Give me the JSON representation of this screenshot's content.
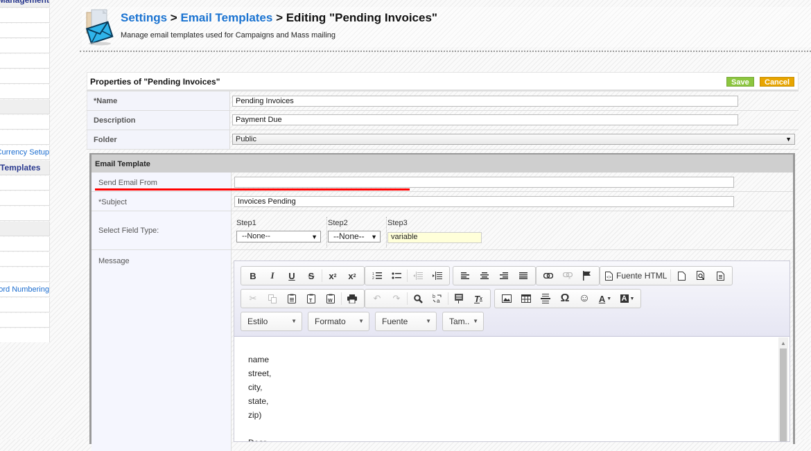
{
  "sidebar": {
    "items": [
      {
        "label": "Management",
        "type": "head"
      },
      {
        "label": "",
        "type": "item"
      },
      {
        "label": "",
        "type": "item"
      },
      {
        "label": "",
        "type": "item"
      },
      {
        "label": "",
        "type": "item"
      },
      {
        "label": "",
        "type": "item"
      },
      {
        "label": "",
        "type": "head"
      },
      {
        "label": "",
        "type": "item"
      },
      {
        "label": "",
        "type": "item"
      },
      {
        "label": "Currency Setup",
        "type": "link"
      },
      {
        "label": "Templates",
        "type": "head"
      },
      {
        "label": "",
        "type": "item"
      },
      {
        "label": "",
        "type": "item"
      },
      {
        "label": "",
        "type": "item"
      },
      {
        "label": "",
        "type": "head"
      },
      {
        "label": "",
        "type": "item"
      },
      {
        "label": "",
        "type": "item"
      },
      {
        "label": "",
        "type": "item"
      },
      {
        "label": "Record Numbering",
        "type": "link"
      },
      {
        "label": "",
        "type": "item"
      },
      {
        "label": "",
        "type": "item"
      },
      {
        "label": "",
        "type": "item"
      }
    ]
  },
  "header": {
    "breadcrumb": {
      "settings": "Settings",
      "sep1": " > ",
      "email_templates": "Email Templates",
      "sep2": " > ",
      "current": "Editing \"Pending Invoices\""
    },
    "subtitle": "Manage email templates used for Campaigns and Mass mailing"
  },
  "properties": {
    "title": "Properties of \"Pending Invoices\"",
    "save_label": "Save",
    "cancel_label": "Cancel",
    "name": {
      "required_mark": "*",
      "label": "Name",
      "value": "Pending Invoices"
    },
    "description": {
      "label": "Description",
      "value": "Payment Due"
    },
    "folder": {
      "label": "Folder",
      "value": "Public"
    }
  },
  "email_template": {
    "title": "Email Template",
    "send_from": {
      "label": "Send Email From",
      "value": ""
    },
    "subject": {
      "required_mark": "*",
      "label": "Subject",
      "value": "Invoices Pending"
    },
    "field_type": {
      "label": "Select Field Type:",
      "step1": {
        "label": "Step1",
        "value": "--None--"
      },
      "step2": {
        "label": "Step2",
        "value": "--None--"
      },
      "step3": {
        "label": "Step3",
        "value": "variable"
      }
    },
    "message": {
      "label": "Message",
      "toolbar": {
        "source_label": "Fuente HTML",
        "combos": {
          "style": "Estilo",
          "format": "Formato",
          "font": "Fuente",
          "size": "Tam.."
        }
      },
      "content_lines": [
        "name",
        "street,",
        "city,",
        "state,",
        "zip)",
        "",
        "Dear"
      ]
    }
  },
  "colors": {
    "link": "#1a73d1",
    "save": "#8cc63f",
    "cancel": "#e8a500",
    "highlight_line": "#ff0000",
    "variable_bg": "#ffffd9"
  }
}
